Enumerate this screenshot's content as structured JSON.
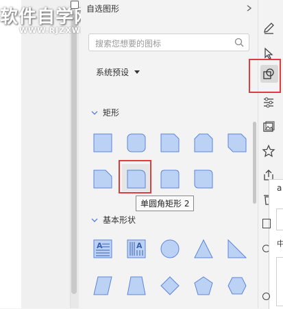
{
  "watermark": {
    "title": "软件自学网",
    "url": "WWW.RJZXW.COM"
  },
  "panel": {
    "title": "自选图形",
    "pin_icon": "pin-icon",
    "search_placeholder": "搜索您想要的图标",
    "preset_label": "系统预设",
    "sections": [
      {
        "title": "矩形"
      },
      {
        "title": "基本形状"
      }
    ],
    "tooltip": "单圆角矩形 2"
  },
  "toolbar": {
    "items": [
      "pen-icon",
      "cursor-icon",
      "shapes-icon",
      "sliders-icon",
      "image-frame-icon",
      "star-icon",
      "share-icon"
    ]
  },
  "side_fragment": {
    "text_a": "a",
    "text_zh": "中"
  },
  "colors": {
    "shape_fill": "#bcd2f5",
    "shape_stroke": "#5b84d8",
    "highlight": "#e23b3b"
  }
}
